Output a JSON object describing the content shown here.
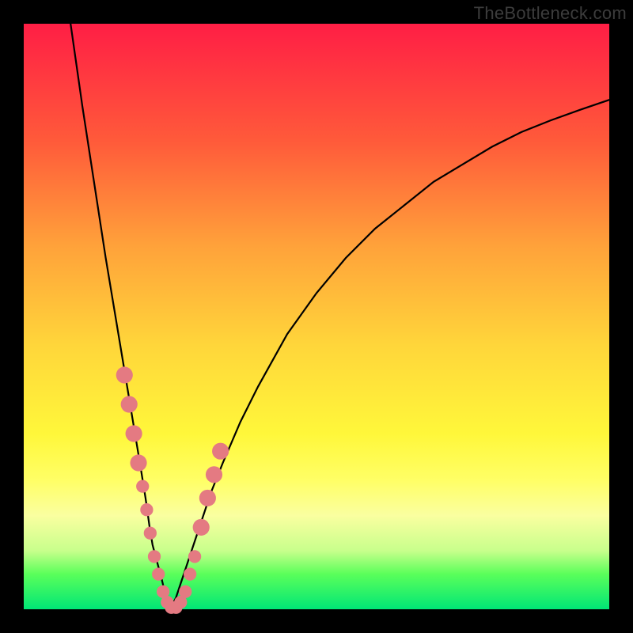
{
  "watermark": "TheBottleneck.com",
  "chart_data": {
    "type": "line",
    "title": "",
    "xlabel": "",
    "ylabel": "",
    "xlim": [
      0,
      100
    ],
    "ylim": [
      0,
      100
    ],
    "series": [
      {
        "name": "left-branch",
        "x": [
          8,
          10,
          12,
          14,
          16,
          17,
          18,
          19,
          20,
          20.8,
          21.5,
          22,
          22.8,
          23.6,
          24.3,
          25
        ],
        "values": [
          100,
          86,
          73,
          60,
          48,
          42,
          36,
          30,
          24,
          19,
          14,
          11,
          8,
          5,
          2,
          0
        ]
      },
      {
        "name": "right-branch",
        "x": [
          25,
          26,
          27,
          28,
          30,
          32,
          34,
          37,
          40,
          45,
          50,
          55,
          60,
          65,
          70,
          75,
          80,
          85,
          90,
          95,
          100
        ],
        "values": [
          0,
          2,
          5,
          8,
          14,
          20,
          25,
          32,
          38,
          47,
          54,
          60,
          65,
          69,
          73,
          76,
          79,
          81.5,
          83.5,
          85.3,
          87
        ]
      }
    ],
    "markers": {
      "name": "highlight-dots",
      "color": "#e47a82",
      "points": [
        {
          "x": 17.2,
          "y": 40,
          "r": 1.3
        },
        {
          "x": 18.0,
          "y": 35,
          "r": 1.3
        },
        {
          "x": 18.8,
          "y": 30,
          "r": 1.3
        },
        {
          "x": 19.6,
          "y": 25,
          "r": 1.3
        },
        {
          "x": 20.3,
          "y": 21,
          "r": 1.0
        },
        {
          "x": 21.0,
          "y": 17,
          "r": 1.0
        },
        {
          "x": 21.6,
          "y": 13,
          "r": 1.0
        },
        {
          "x": 22.3,
          "y": 9,
          "r": 1.0
        },
        {
          "x": 23.0,
          "y": 6,
          "r": 1.0
        },
        {
          "x": 23.8,
          "y": 3,
          "r": 1.0
        },
        {
          "x": 24.5,
          "y": 1.2,
          "r": 1.0
        },
        {
          "x": 25.2,
          "y": 0.3,
          "r": 1.0
        },
        {
          "x": 26.0,
          "y": 0.3,
          "r": 1.0
        },
        {
          "x": 26.8,
          "y": 1.2,
          "r": 1.0
        },
        {
          "x": 27.6,
          "y": 3,
          "r": 1.0
        },
        {
          "x": 28.4,
          "y": 6,
          "r": 1.0
        },
        {
          "x": 29.2,
          "y": 9,
          "r": 1.0
        },
        {
          "x": 30.3,
          "y": 14,
          "r": 1.3
        },
        {
          "x": 31.4,
          "y": 19,
          "r": 1.3
        },
        {
          "x": 32.5,
          "y": 23,
          "r": 1.3
        },
        {
          "x": 33.6,
          "y": 27,
          "r": 1.3
        }
      ]
    }
  }
}
